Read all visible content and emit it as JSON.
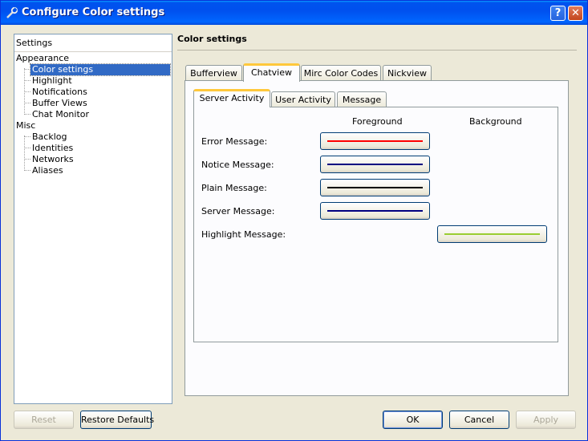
{
  "window": {
    "title": "Configure Color settings",
    "help_label": "?",
    "close_label": "✕"
  },
  "tree": {
    "header": "Settings",
    "groups": [
      {
        "label": "Appearance",
        "items": [
          "Color settings",
          "Highlight",
          "Notifications",
          "Buffer Views",
          "Chat Monitor"
        ]
      },
      {
        "label": "Misc",
        "items": [
          "Backlog",
          "Identities",
          "Networks",
          "Aliases"
        ]
      }
    ],
    "selected": "Color settings"
  },
  "section": {
    "title": "Color settings"
  },
  "outer_tabs": [
    "Bufferview",
    "Chatview",
    "Mirc Color Codes",
    "Nickview"
  ],
  "outer_active": "Chatview",
  "inner_tabs": [
    "Server Activity",
    "User Activity",
    "Message"
  ],
  "inner_active": "Server Activity",
  "columns": {
    "foreground": "Foreground",
    "background": "Background"
  },
  "rows": [
    {
      "label": "Error Message:",
      "fg_color": "#ff0000"
    },
    {
      "label": "Notice Message:",
      "fg_color": "#000080"
    },
    {
      "label": "Plain Message:",
      "fg_color": "#000000"
    },
    {
      "label": "Server Message:",
      "fg_color": "#000080"
    },
    {
      "label": "Highlight Message:",
      "bg_color": "#9acd32"
    }
  ],
  "buttons": {
    "reset": "Reset",
    "restore": "Restore Defaults",
    "ok": "OK",
    "cancel": "Cancel",
    "apply": "Apply"
  }
}
